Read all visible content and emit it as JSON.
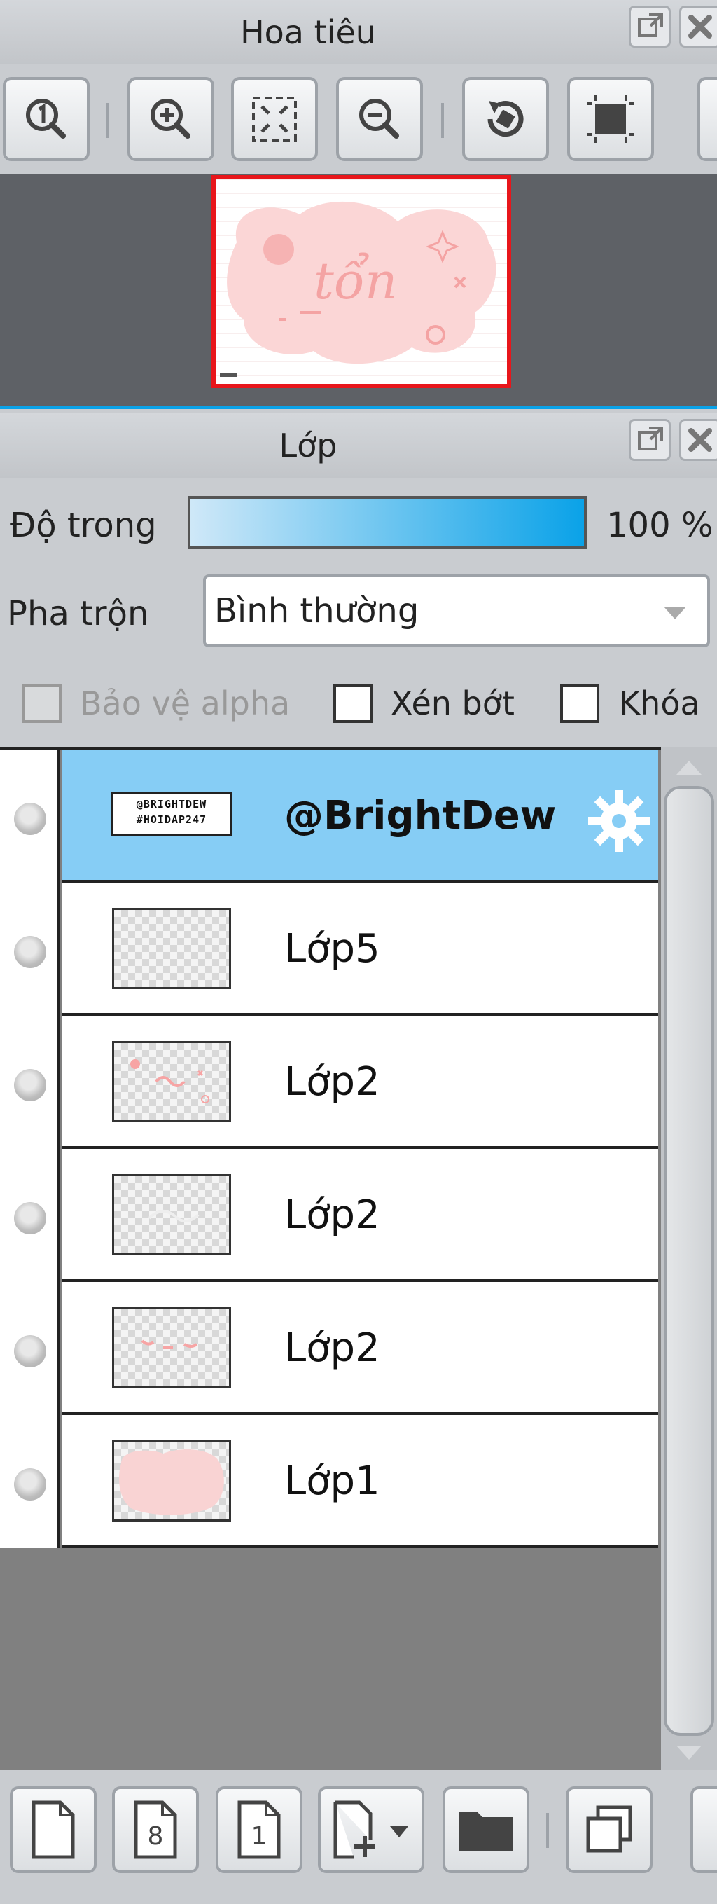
{
  "navigator": {
    "title": "Hoa tiêu",
    "toolbar": {
      "icons": [
        "zoom-actual-size-icon",
        "zoom-in-icon",
        "fit-to-window-icon",
        "zoom-out-icon",
        "rotate-reset-icon",
        "flip-canvas-icon"
      ]
    },
    "preview_text": "tổn"
  },
  "layers": {
    "title": "Lớp",
    "opacity_label": "Độ trong",
    "opacity_value": "100 %",
    "opacity_fraction": 1.0,
    "blend_label": "Pha trộn",
    "blend_value": "Bình thường",
    "protect_alpha_label": "Bảo vệ alpha",
    "clip_label": "Xén bớt",
    "lock_label": "Khóa",
    "items": [
      {
        "name": "@BrightDew",
        "thumb_text": "@BRIGHTDEW #HOIDAP247",
        "selected": true
      },
      {
        "name": "Lớp5",
        "selected": false
      },
      {
        "name": "Lớp2",
        "selected": false
      },
      {
        "name": "Lớp2",
        "selected": false
      },
      {
        "name": "Lớp2",
        "selected": false
      },
      {
        "name": "Lớp1",
        "selected": false
      }
    ],
    "bottom_toolbar": {
      "icons": [
        "new-layer-icon",
        "new-8bit-layer-icon",
        "new-1bit-layer-icon",
        "add-layer-menu-icon",
        "new-folder-icon",
        "duplicate-layer-icon"
      ],
      "badge_8": "8",
      "badge_1": "1"
    }
  },
  "colors": {
    "accent": "#0aa2e8",
    "selected_row": "#86cdf5",
    "panel_bg": "#c9ccd0",
    "preview_frame": "#e8161b"
  }
}
